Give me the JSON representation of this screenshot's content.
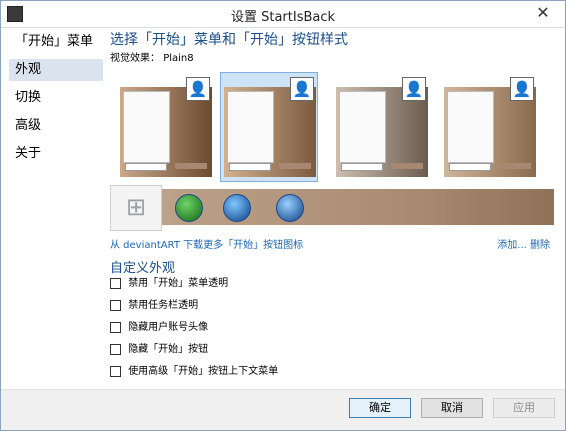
{
  "window": {
    "title": "设置 StartIsBack",
    "close_label": "✕"
  },
  "sidebar": {
    "items": [
      {
        "label": "「开始」菜单"
      },
      {
        "label": "外观"
      },
      {
        "label": "切换"
      },
      {
        "label": "高级"
      },
      {
        "label": "关于"
      }
    ]
  },
  "main": {
    "section_title": "选择「开始」菜单和「开始」按钮样式",
    "visual_effect_label": "视觉效果：",
    "visual_effect_value": "Plain8",
    "themes": [
      {
        "selected": false
      },
      {
        "selected": true
      },
      {
        "selected": false
      },
      {
        "selected": false
      }
    ],
    "start_buttons": [
      {
        "icon": "windows-logo"
      },
      {
        "icon": "green-orb"
      },
      {
        "icon": "win7-orb"
      },
      {
        "icon": "win7-orb"
      }
    ],
    "download_link": "从 deviantART 下载更多「开始」按钮图标",
    "add_link": "添加...",
    "delete_link": "删除",
    "customize_title": "自定义外观",
    "options": [
      {
        "label": "禁用「开始」菜单透明"
      },
      {
        "label": "禁用任务栏透明"
      },
      {
        "label": "隐藏用户账号头像"
      },
      {
        "label": "隐藏「开始」按钮"
      },
      {
        "label": "使用高级「开始」按钮上下文菜单"
      }
    ]
  },
  "footer": {
    "ok_label": "确定",
    "cancel_label": "取消",
    "apply_label": "应用"
  }
}
